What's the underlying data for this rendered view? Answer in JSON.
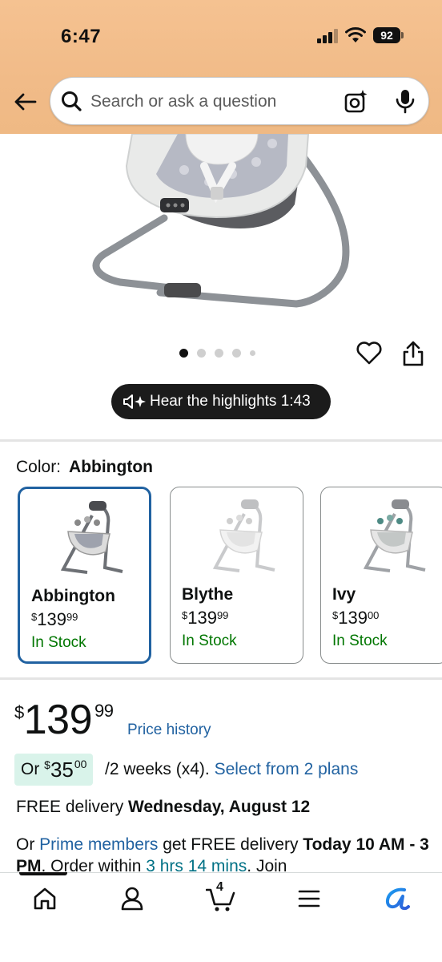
{
  "status_bar": {
    "time": "6:47",
    "battery": "92"
  },
  "header": {
    "back_icon": "arrow-left-icon",
    "search": {
      "placeholder": "Search or ask a question",
      "value": ""
    }
  },
  "gallery": {
    "image_count": 5,
    "active_index": 0,
    "highlights_label": "Hear the highlights 1:43"
  },
  "color": {
    "label": "Color:",
    "selected": "Abbington",
    "options": [
      {
        "name": "Abbington",
        "currency": "$",
        "whole": "139",
        "fraction": "99",
        "stock": "In Stock"
      },
      {
        "name": "Blythe",
        "currency": "$",
        "whole": "139",
        "fraction": "99",
        "stock": "In Stock"
      },
      {
        "name": "Ivy",
        "currency": "$",
        "whole": "139",
        "fraction": "00",
        "stock": "In Stock"
      }
    ]
  },
  "price": {
    "currency": "$",
    "whole": "139",
    "fraction": "99",
    "history_link": "Price history"
  },
  "installment": {
    "prefix": "Or",
    "currency": "$",
    "whole": "35",
    "fraction": "00",
    "term": "/2 weeks (x4).",
    "plans_link": "Select from 2 plans"
  },
  "delivery": {
    "prefix": "FREE delivery",
    "date": "Wednesday, August 12"
  },
  "prime": {
    "or": "Or",
    "members_link": "Prime members",
    "middle": "get FREE delivery",
    "today": "Today",
    "window": "10 AM - 3 PM",
    "order_within": ". Order within",
    "countdown": "3 hrs 14 mins",
    "join": ". Join"
  },
  "bottom_nav": {
    "cart_count": "4",
    "items": [
      "home-icon",
      "account-icon",
      "cart-icon",
      "menu-icon",
      "rufus-icon"
    ]
  },
  "colors": {
    "header_bg": "#f3be8b",
    "link": "#2162a1",
    "in_stock": "#007600",
    "selected_border": "#2162a1",
    "installment_bg": "#d9f3ea"
  }
}
